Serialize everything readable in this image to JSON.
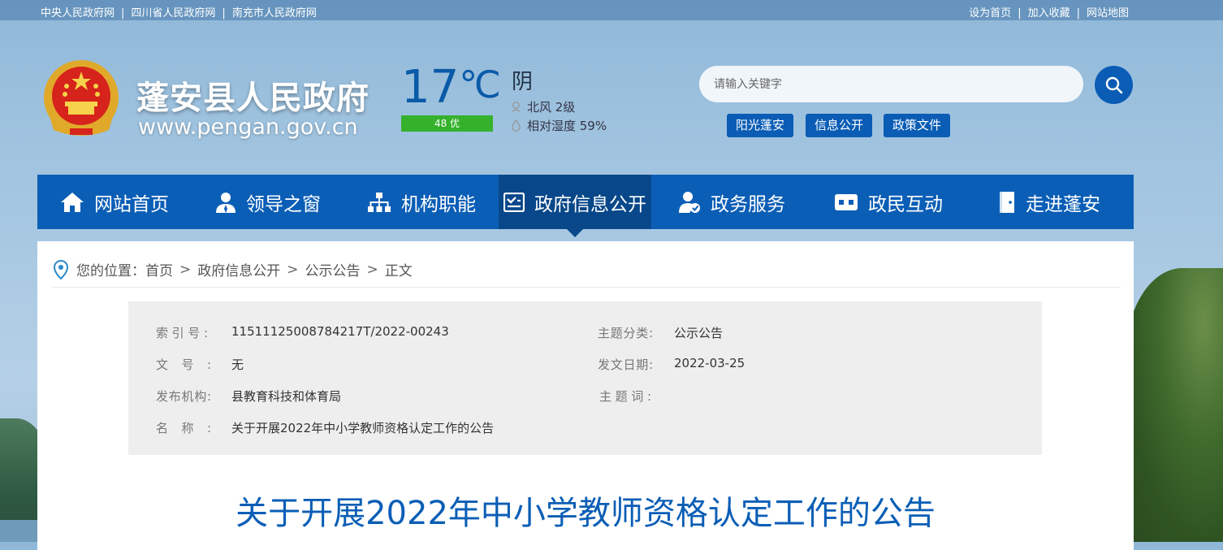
{
  "topbar": {
    "links_left": [
      "中央人民政府网",
      "四川省人民政府网",
      "南充市人民政府网"
    ],
    "links_right": [
      "设为首页",
      "加入收藏",
      "网站地图"
    ],
    "separator": "|"
  },
  "header": {
    "site_title": "蓬安县人民政府",
    "site_url": "www.pengan.gov.cn"
  },
  "weather": {
    "temperature": "17",
    "unit": "℃",
    "condition": "阴",
    "aqi": "48 优",
    "wind": "北风 2级",
    "humidity": "相对湿度 59%"
  },
  "search": {
    "placeholder": "请输入关键字",
    "quick_links": [
      "阳光蓬安",
      "信息公开",
      "政策文件"
    ]
  },
  "nav": {
    "items": [
      {
        "label": "网站首页",
        "icon": "home-icon"
      },
      {
        "label": "领导之窗",
        "icon": "user-icon"
      },
      {
        "label": "机构职能",
        "icon": "org-chart-icon"
      },
      {
        "label": "政府信息公开",
        "icon": "document-check-icon",
        "active": true
      },
      {
        "label": "政务服务",
        "icon": "service-icon"
      },
      {
        "label": "政民互动",
        "icon": "chat-icon"
      },
      {
        "label": "走进蓬安",
        "icon": "door-icon"
      }
    ]
  },
  "breadcrumb": {
    "prefix": "您的位置：",
    "items": [
      "首页",
      "政府信息公开",
      "公示公告",
      "正文"
    ],
    "separator": ">"
  },
  "meta": {
    "index_label": "索引号:",
    "index_value": "11511125008784217T/2022-00243",
    "topic_label": "主题分类:",
    "topic_value": "公示公告",
    "docno_label": "文号:",
    "docno_value": "无",
    "date_label": "发文日期:",
    "date_value": "2022-03-25",
    "org_label": "发布机构:",
    "org_value": "县教育科技和体育局",
    "keyword_label": "主题词:",
    "keyword_value": "",
    "name_label": "名称:",
    "name_value": "关于开展2022年中小学教师资格认定工作的公告"
  },
  "document": {
    "title": "关于开展2022年中小学教师资格认定工作的公告"
  },
  "colors": {
    "primary": "#0b5eb6",
    "nav_active": "#084789",
    "aqi_good": "#35b12c"
  }
}
